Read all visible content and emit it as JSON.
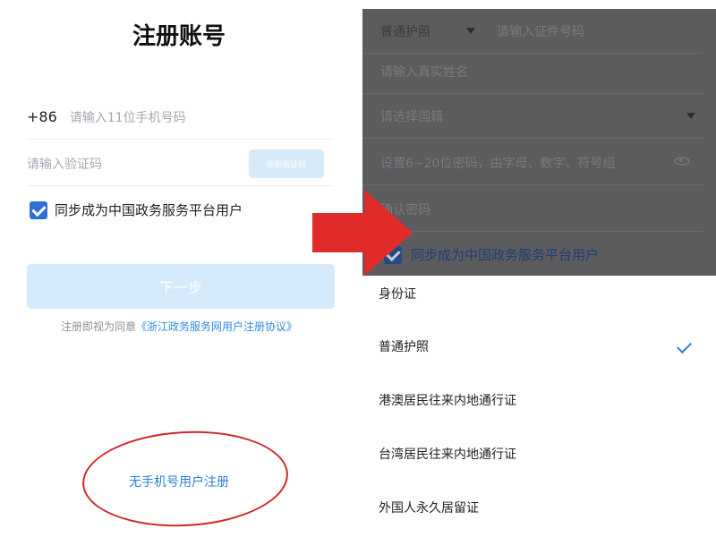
{
  "left": {
    "title": "注册账号",
    "phone_prefix": "+86",
    "phone_placeholder": "请输入11位手机号码",
    "code_placeholder": "请输入验证码",
    "get_code_label": "获取验证码",
    "sync_checkbox_label": "同步成为中国政务服务平台用户",
    "sync_checked": true,
    "next_label": "下一步",
    "agree_prefix": "注册即视为同意",
    "agree_link": "《浙江政务服务网用户注册协议》",
    "no_phone_link": "无手机号用户注册"
  },
  "right": {
    "doc_type_value": "普通护照",
    "doc_number_placeholder": "请输入证件号码",
    "name_placeholder": "请输入真实姓名",
    "nationality_placeholder": "请选择国籍",
    "password_placeholder": "设置6~20位密码，由字母、数字、符号组",
    "confirm_placeholder": "确认密码",
    "sync_checkbox_label": "同步成为中国政务服务平台用户",
    "options": [
      {
        "label": "身份证",
        "selected": false
      },
      {
        "label": "普通护照",
        "selected": true
      },
      {
        "label": "港澳居民往来内地通行证",
        "selected": false
      },
      {
        "label": "台湾居民往来内地通行证",
        "selected": false
      },
      {
        "label": "外国人永久居留证",
        "selected": false
      }
    ]
  },
  "colors": {
    "accent": "#2d7fd6",
    "highlight_ellipse": "#d32626",
    "arrow": "#e12a2a",
    "overlay": "#5c5c5e"
  }
}
